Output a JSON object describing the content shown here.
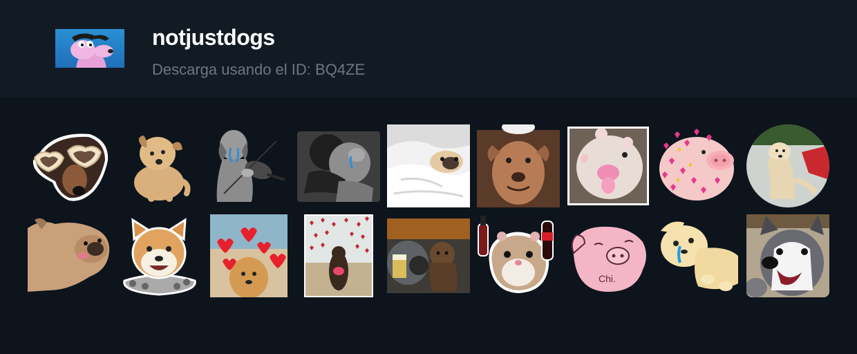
{
  "pack": {
    "name": "notjustdogs",
    "download_hint": "Descarga usando el ID: BQ4ZE"
  },
  "stickers": [
    {
      "name": "sticker-dog-heart-glasses"
    },
    {
      "name": "sticker-dog-sitting"
    },
    {
      "name": "sticker-dog-violin"
    },
    {
      "name": "sticker-dogs-hugging"
    },
    {
      "name": "sticker-pug-in-bed"
    },
    {
      "name": "sticker-pitbull-smiling"
    },
    {
      "name": "sticker-hamster-shocked"
    },
    {
      "name": "sticker-pig-with-hearts"
    },
    {
      "name": "sticker-dog-circle"
    },
    {
      "name": "sticker-pug-lying"
    },
    {
      "name": "sticker-shiba-smiling"
    },
    {
      "name": "sticker-golden-hearts"
    },
    {
      "name": "sticker-dog-beach-hearts"
    },
    {
      "name": "sticker-dog-car-beer"
    },
    {
      "name": "sticker-hamster-drinks"
    },
    {
      "name": "sticker-pink-pig-chi"
    },
    {
      "name": "sticker-puppy-crying"
    },
    {
      "name": "sticker-husky-laughing"
    }
  ],
  "colors": {
    "header_bg": "#121b24",
    "page_bg": "#0d141c",
    "title": "#ffffff",
    "subtitle": "#6e7781"
  }
}
